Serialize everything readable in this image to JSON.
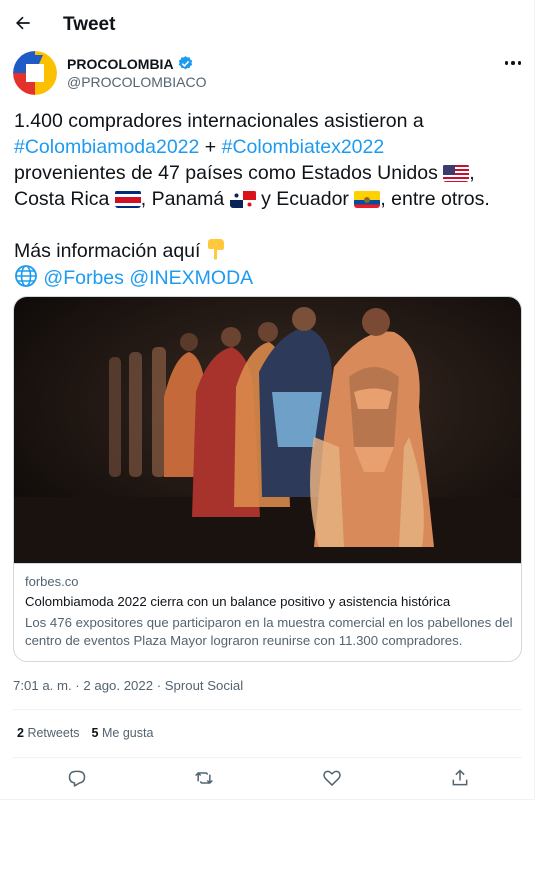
{
  "header": {
    "title": "Tweet"
  },
  "author": {
    "name": "PROCOLOMBIA",
    "handle": "@PROCOLOMBIACO",
    "verified": true
  },
  "tweet": {
    "line1": "1.400 compradores internacionales asistieron a",
    "hashtag1": "#Colombiamoda2022",
    "plus": "+",
    "hashtag2": "#Colombiatex2022",
    "line3": "provenientes de 47 países como Estados Unidos",
    "line4_a": "Costa Rica",
    "line4_b": ", Panamá",
    "line4_c": "y Ecuador",
    "line4_d": ", entre otros.",
    "more_info": "Más información aquí",
    "mention1": "@Forbes",
    "mention2": "@INEXMODA"
  },
  "card": {
    "domain": "forbes.co",
    "title": "Colombiamoda 2022 cierra con un balance positivo y asistencia histórica",
    "description": "Los 476 expositores que participaron en la muestra comercial en los pabellones del centro de eventos Plaza Mayor lograron reunirse con 11.300 compradores."
  },
  "meta": {
    "timestamp": "7:01 a. m. · 2 ago. 2022 · Sprout Social"
  },
  "stats": {
    "retweets_count": "2",
    "retweets_label": "Retweets",
    "likes_count": "5",
    "likes_label": "Me gusta"
  },
  "colors": {
    "link": "#1d9bf0",
    "secondary": "#536471",
    "border": "#cfd9de"
  },
  "icons": [
    "back-arrow-icon",
    "verified-badge-icon",
    "more-icon",
    "point-down-emoji",
    "globe-emoji",
    "reply-icon",
    "retweet-icon",
    "like-icon",
    "share-icon"
  ]
}
